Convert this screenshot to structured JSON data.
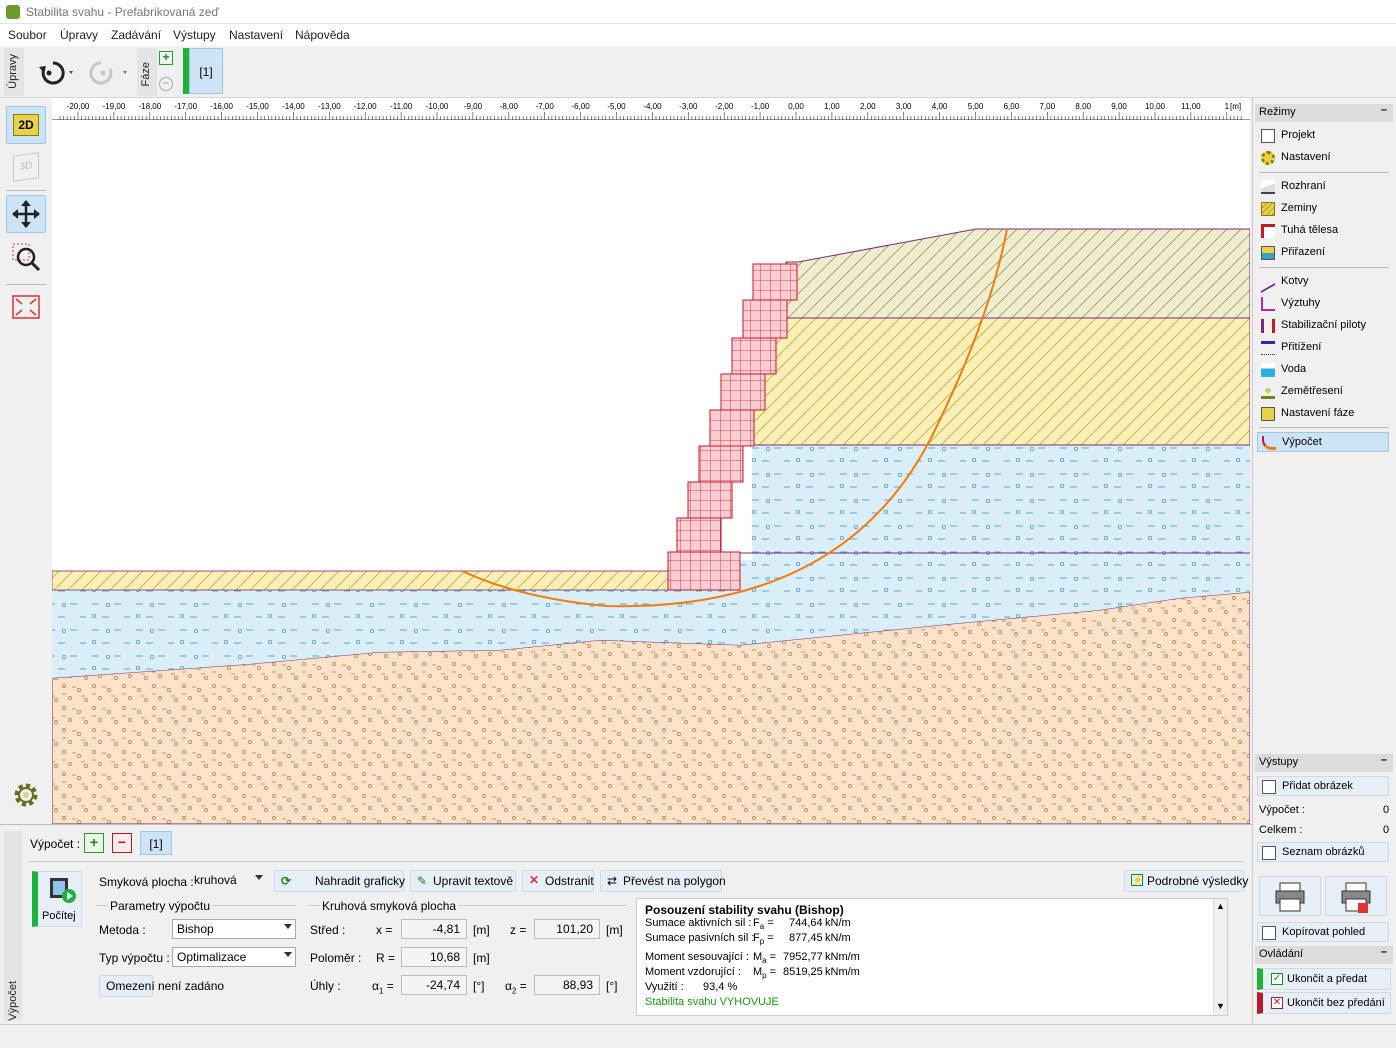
{
  "window": {
    "title": "Stabilita svahu - Prefabrikovaná zeď"
  },
  "menu": [
    "Soubor",
    "Úpravy",
    "Zadávání",
    "Výstupy",
    "Nastavení",
    "Nápověda"
  ],
  "toolbar": {
    "edit_label": "Úpravy",
    "phase_label": "Fáze",
    "phase_tab": "[1]"
  },
  "left_tools": {
    "view2d": "2D",
    "view3d": "3D"
  },
  "ruler": {
    "ticks": [
      "-20,00",
      "-19,00",
      "-18,00",
      "-17,00",
      "-16,00",
      "-15,00",
      "-14,00",
      "-13,00",
      "-12,00",
      "-11,00",
      "-10,00",
      "-9,00",
      "-8,00",
      "-7,00",
      "-6,00",
      "-5,00",
      "-4,00",
      "-3,00",
      "-2,00",
      "-1,00",
      "0,00",
      "1,00",
      "2,00",
      "3,00",
      "4,00",
      "5,00",
      "6,00",
      "7,00",
      "8,00",
      "9,00",
      "10,00",
      "11,00",
      "1"
    ],
    "unit": "[m]"
  },
  "modes": {
    "title": "Režimy",
    "group1": [
      "Projekt",
      "Nastavení"
    ],
    "group2": [
      "Rozhraní",
      "Zeminy",
      "Tuhá tělesa",
      "Přiřazení"
    ],
    "group3": [
      "Kotvy",
      "Výztuhy",
      "Stabilizační piloty",
      "Přitížení",
      "Voda",
      "Zemětřesení",
      "Nastavení fáze"
    ],
    "group4": [
      "Výpočet"
    ]
  },
  "outputs": {
    "title": "Výstupy",
    "add_image": "Přidat obrázek",
    "calc_label": "Výpočet :",
    "calc_value": "0",
    "total_label": "Celkem :",
    "total_value": "0",
    "image_list": "Seznam obrázků",
    "copy_view": "Kopírovat pohled"
  },
  "control": {
    "title": "Ovládání",
    "finish": "Ukončit a předat",
    "finish_no": "Ukončit bez předání"
  },
  "bottom": {
    "side_label": "Výpočet",
    "calc_label": "Výpočet :",
    "calc_tab": "[1]",
    "run_button": "Počítej",
    "slip_label": "Smyková plocha :",
    "slip_value": "kruhová",
    "replace_graphic": "Nahradit graficky",
    "edit_text": "Upravit textově",
    "remove": "Odstranit",
    "to_polygon": "Převést na polygon",
    "detailed": "Podrobné výsledky",
    "params_title": "Parametry výpočtu",
    "method_label": "Metoda :",
    "method_value": "Bishop",
    "calc_type_label": "Typ výpočtu :",
    "calc_type_value": "Optimalizace",
    "restriction_button": "Omezení",
    "restriction_value": "není zadáno",
    "circle_title": "Kruhová smyková plocha",
    "center_label": "Střed :",
    "x_label": "x =",
    "x_value": "-4,81",
    "z_label": "z =",
    "z_value": "101,20",
    "radius_label": "Poloměr :",
    "r_label": "R =",
    "r_value": "10,68",
    "angles_label": "Úhly :",
    "a1_value": "-24,74",
    "a2_value": "88,93",
    "unit_m": "[m]",
    "unit_deg": "[°]"
  },
  "results": {
    "title": "Posouzení stability svahu (Bishop)",
    "active_label": "Sumace aktivních sil :",
    "active_value": "744,64",
    "passive_label": "Sumace pasivních sil :",
    "passive_value": "877,45",
    "force_unit": "kN/m",
    "moment_slide_label": "Moment sesouvající :",
    "moment_slide_value": "7952,77",
    "moment_resist_label": "Moment vzdorující :",
    "moment_resist_value": "8519,25",
    "moment_unit": "kNm/m",
    "utilization_label": "Využití :",
    "utilization_value": "93,4 %",
    "verdict": "Stabilita svahu VYHOVUJE"
  },
  "colors": {
    "accent_green": "#1db23a",
    "ok_text": "#1a9a1a",
    "slip_circle": "#f07d12",
    "selected": "#cde4f7"
  }
}
